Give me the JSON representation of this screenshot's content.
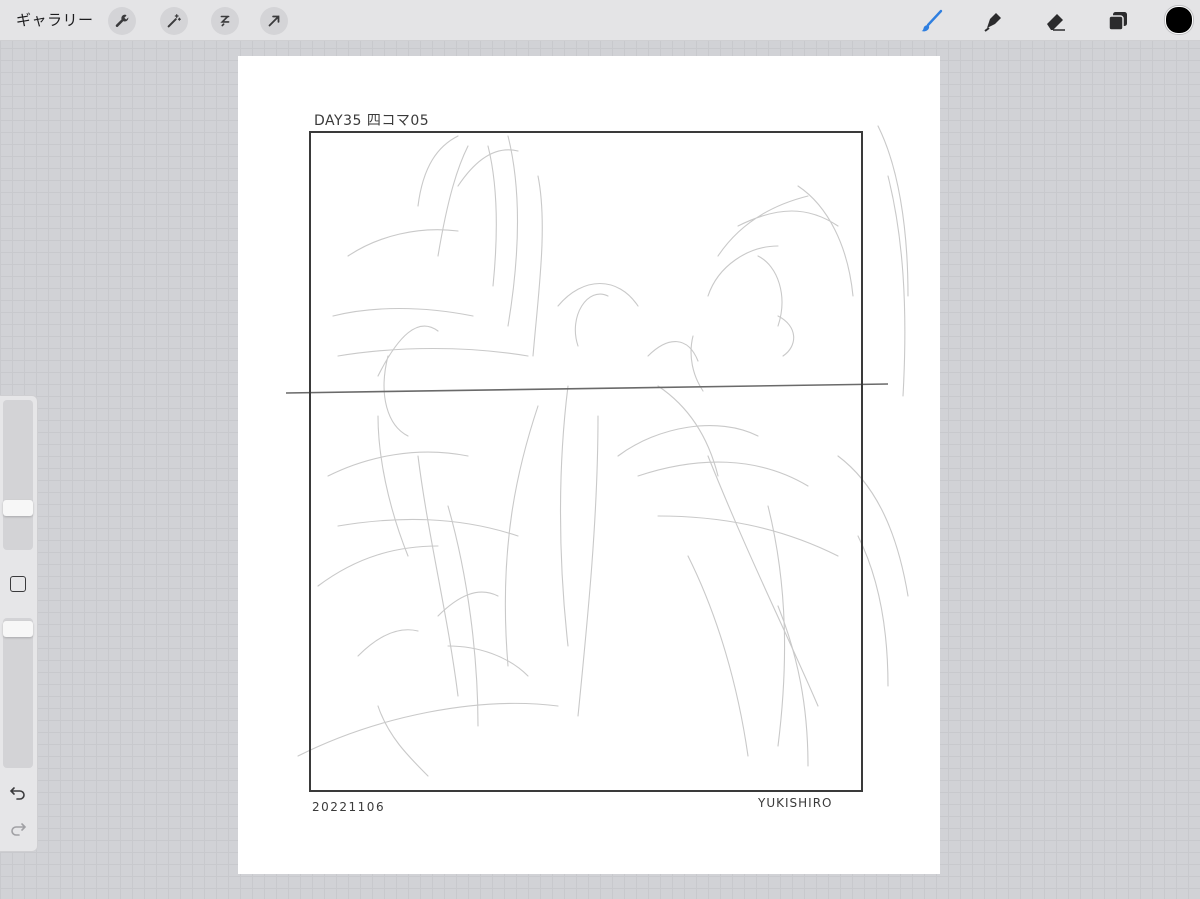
{
  "topbar": {
    "gallery_label": "ギャラリー",
    "left_tools": [
      "wrench-icon",
      "magic-wand-icon",
      "selection-icon",
      "transform-arrow-icon"
    ],
    "right_tools": [
      "brush-icon",
      "smudge-icon",
      "eraser-icon",
      "layers-icon"
    ],
    "active_tool": "brush-icon",
    "accent_color": "#2f7fe0",
    "current_color": "#000000"
  },
  "sidebar": {
    "controls": [
      "brush-size-slider",
      "modify-button",
      "opacity-slider",
      "undo-icon",
      "redo-icon"
    ]
  },
  "canvas": {
    "header_text": "DAY35 四コマ05",
    "date_text": "20221106",
    "signature_text": "YUKISHIRO"
  }
}
